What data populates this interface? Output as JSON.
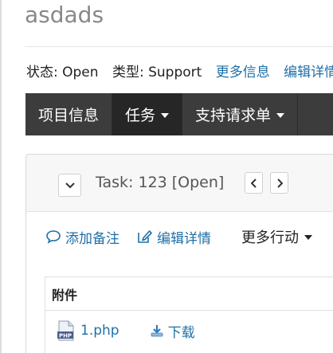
{
  "page": {
    "title": "asdads"
  },
  "meta": {
    "status": "状态: Open",
    "type": "类型: Support",
    "more_info": "更多信息",
    "edit_details": "编辑详情"
  },
  "nav": {
    "items": [
      {
        "label": "项目信息"
      },
      {
        "label": "任务"
      },
      {
        "label": "支持请求单"
      }
    ]
  },
  "task": {
    "title": "Task: 123 [Open]"
  },
  "actions": {
    "add_note": "添加备注",
    "edit_details": "编辑详情",
    "more_actions": "更多行动"
  },
  "attachments": {
    "header": "附件",
    "items": [
      {
        "filename": "1.php",
        "download_label": "下载"
      }
    ]
  },
  "colors": {
    "navbar_bg": "#3c3c3c",
    "navbar_active": "#262626",
    "link": "#1f6fa8"
  },
  "icons": [
    "chevron-down-icon",
    "chevron-left-icon",
    "chevron-right-icon",
    "comment-icon",
    "edit-icon",
    "php-file-icon",
    "download-icon"
  ]
}
